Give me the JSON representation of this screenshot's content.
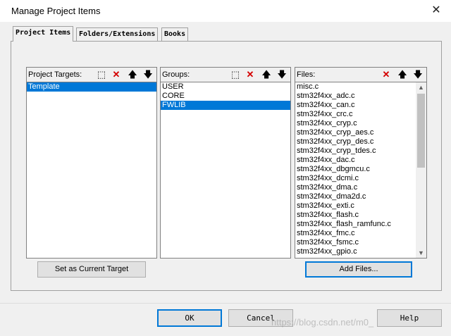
{
  "window": {
    "title": "Manage Project Items"
  },
  "tabs": [
    {
      "label": "Project Items"
    },
    {
      "label": "Folders/Extensions"
    },
    {
      "label": "Books"
    }
  ],
  "targets": {
    "header": "Project Targets:",
    "items": [
      "Template"
    ],
    "selected_index": 0
  },
  "groups": {
    "header": "Groups:",
    "items": [
      "USER",
      "CORE",
      "FWLIB"
    ],
    "selected_index": 2
  },
  "files": {
    "header": "Files:",
    "items": [
      "misc.c",
      "stm32f4xx_adc.c",
      "stm32f4xx_can.c",
      "stm32f4xx_crc.c",
      "stm32f4xx_cryp.c",
      "stm32f4xx_cryp_aes.c",
      "stm32f4xx_cryp_des.c",
      "stm32f4xx_cryp_tdes.c",
      "stm32f4xx_dac.c",
      "stm32f4xx_dbgmcu.c",
      "stm32f4xx_dcmi.c",
      "stm32f4xx_dma.c",
      "stm32f4xx_dma2d.c",
      "stm32f4xx_exti.c",
      "stm32f4xx_flash.c",
      "stm32f4xx_flash_ramfunc.c",
      "stm32f4xx_fmc.c",
      "stm32f4xx_fsmc.c",
      "stm32f4xx_gpio.c"
    ]
  },
  "buttons": {
    "set_target": "Set as Current Target",
    "add_files": "Add Files...",
    "ok": "OK",
    "cancel": "Cancel",
    "help": "Help"
  },
  "watermark": "https://blog.csdn.net/m0_"
}
